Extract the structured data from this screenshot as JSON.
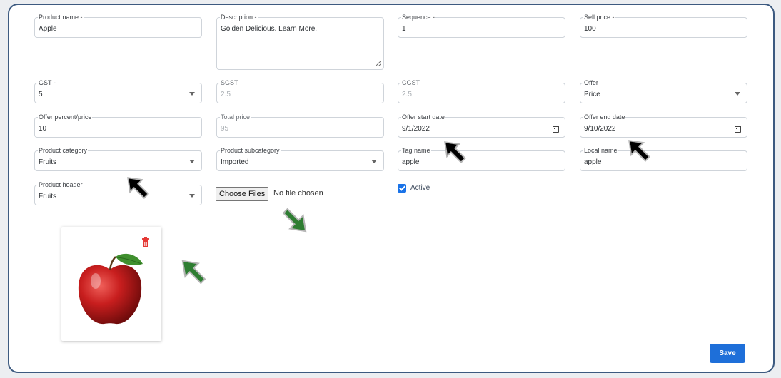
{
  "form": {
    "product_name": {
      "label": "Product name -",
      "value": "Apple"
    },
    "description": {
      "label": "Description -",
      "value": "Golden Delicious. Learn More."
    },
    "sequence": {
      "label": "Sequence -",
      "value": "1"
    },
    "sell_price": {
      "label": "Sell price -",
      "value": "100"
    },
    "gst": {
      "label": "GST -",
      "value": "5"
    },
    "sgst": {
      "label": "SGST",
      "value": "2.5"
    },
    "cgst": {
      "label": "CGST",
      "value": "2.5"
    },
    "offer": {
      "label": "Offer",
      "value": "Price"
    },
    "offer_percent_price": {
      "label": "Offer percent/price",
      "value": "10"
    },
    "total_price": {
      "label": "Total price",
      "value": "95"
    },
    "offer_start_date": {
      "label": "Offer start date",
      "value": "9/1/2022"
    },
    "offer_end_date": {
      "label": "Offer end date",
      "value": "9/10/2022"
    },
    "product_category": {
      "label": "Product category",
      "value": "Fruits"
    },
    "product_subcategory": {
      "label": "Product subcategory",
      "value": "Imported"
    },
    "tag_name": {
      "label": "Tag name",
      "value": "apple"
    },
    "local_name": {
      "label": "Local name",
      "value": "apple"
    },
    "product_header": {
      "label": "Product header",
      "value": "Fruits"
    }
  },
  "file_upload": {
    "button_label": "Choose Files",
    "status": "No file chosen"
  },
  "active": {
    "label": "Active",
    "checked": true
  },
  "image_card": {
    "image_icon": "apple-image",
    "delete_icon": "trash-icon"
  },
  "save_label": "Save",
  "colors": {
    "primary": "#1e6fd9",
    "delete": "#e53935",
    "annotation_black": "#000000",
    "annotation_green": "#2e7d32"
  }
}
